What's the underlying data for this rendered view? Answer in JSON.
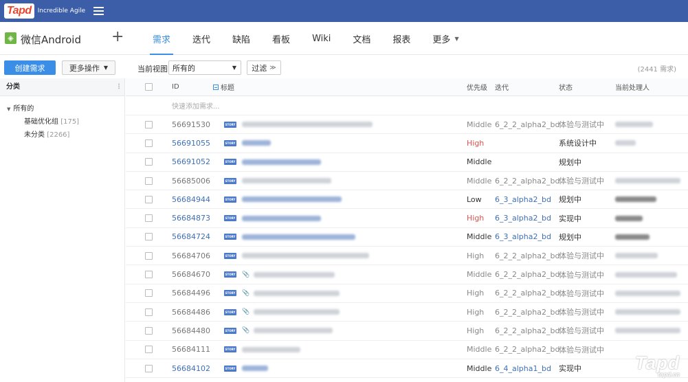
{
  "header": {
    "logo_text": "Tapd",
    "tagline": "Incredible Agile"
  },
  "project": {
    "name": "微信Android",
    "add_label": "+"
  },
  "tabs": [
    {
      "label": "需求",
      "active": true
    },
    {
      "label": "迭代"
    },
    {
      "label": "缺陷"
    },
    {
      "label": "看板"
    },
    {
      "label": "Wiki"
    },
    {
      "label": "文档"
    },
    {
      "label": "报表"
    },
    {
      "label": "更多"
    }
  ],
  "toolbar": {
    "create_label": "创建需求",
    "more_actions_label": "更多操作",
    "view_label": "当前视图",
    "view_value": "所有的",
    "filter_label": "过滤",
    "total_count": "(2441 需求)"
  },
  "sidebar": {
    "heading": "分类",
    "root_label": "所有的",
    "items": [
      {
        "label": "基础优化组",
        "count": "[175]"
      },
      {
        "label": "未分类",
        "count": "[2266]"
      }
    ]
  },
  "table": {
    "columns": {
      "id": "ID",
      "title": "标题",
      "priority": "优先级",
      "iteration": "迭代",
      "status": "状态",
      "owner": "当前处理人"
    },
    "quick_add_placeholder": "快速添加需求...",
    "story_badge": "STORY",
    "rows": [
      {
        "id": "56691530",
        "priority": "Middle",
        "iteration": "6_2_2_alpha2_bd",
        "status": "体验与测试中"
      },
      {
        "id": "56691055",
        "priority": "High",
        "iteration": "",
        "status": "系统设计中"
      },
      {
        "id": "56691052",
        "priority": "Middle",
        "iteration": "",
        "status": "规划中"
      },
      {
        "id": "56685006",
        "priority": "Middle",
        "iteration": "6_2_2_alpha2_bd",
        "status": "体验与测试中"
      },
      {
        "id": "56684944",
        "priority": "Low",
        "iteration": "6_3_alpha2_bd",
        "status": "规划中"
      },
      {
        "id": "56684873",
        "priority": "High",
        "iteration": "6_3_alpha2_bd",
        "status": "实现中"
      },
      {
        "id": "56684724",
        "priority": "Middle",
        "iteration": "6_3_alpha2_bd",
        "status": "规划中"
      },
      {
        "id": "56684706",
        "priority": "High",
        "iteration": "6_2_2_alpha2_bd",
        "status": "体验与测试中"
      },
      {
        "id": "56684670",
        "priority": "Middle",
        "iteration": "6_2_2_alpha2_bd",
        "status": "体验与测试中"
      },
      {
        "id": "56684496",
        "priority": "High",
        "iteration": "6_2_2_alpha2_bd",
        "status": "体验与测试中"
      },
      {
        "id": "56684486",
        "priority": "High",
        "iteration": "6_2_2_alpha2_bd",
        "status": "体验与测试中"
      },
      {
        "id": "56684480",
        "priority": "High",
        "iteration": "6_2_2_alpha2_bd",
        "status": "体验与测试中"
      },
      {
        "id": "56684111",
        "priority": "Middle",
        "iteration": "6_2_2_alpha2_bd",
        "status": "体验与测试中"
      },
      {
        "id": "56684102",
        "priority": "Middle",
        "iteration": "6_4_alpha1_bd",
        "status": "实现中"
      }
    ]
  },
  "watermark": {
    "text": "Tapd",
    "sub": "tapd.cn"
  }
}
